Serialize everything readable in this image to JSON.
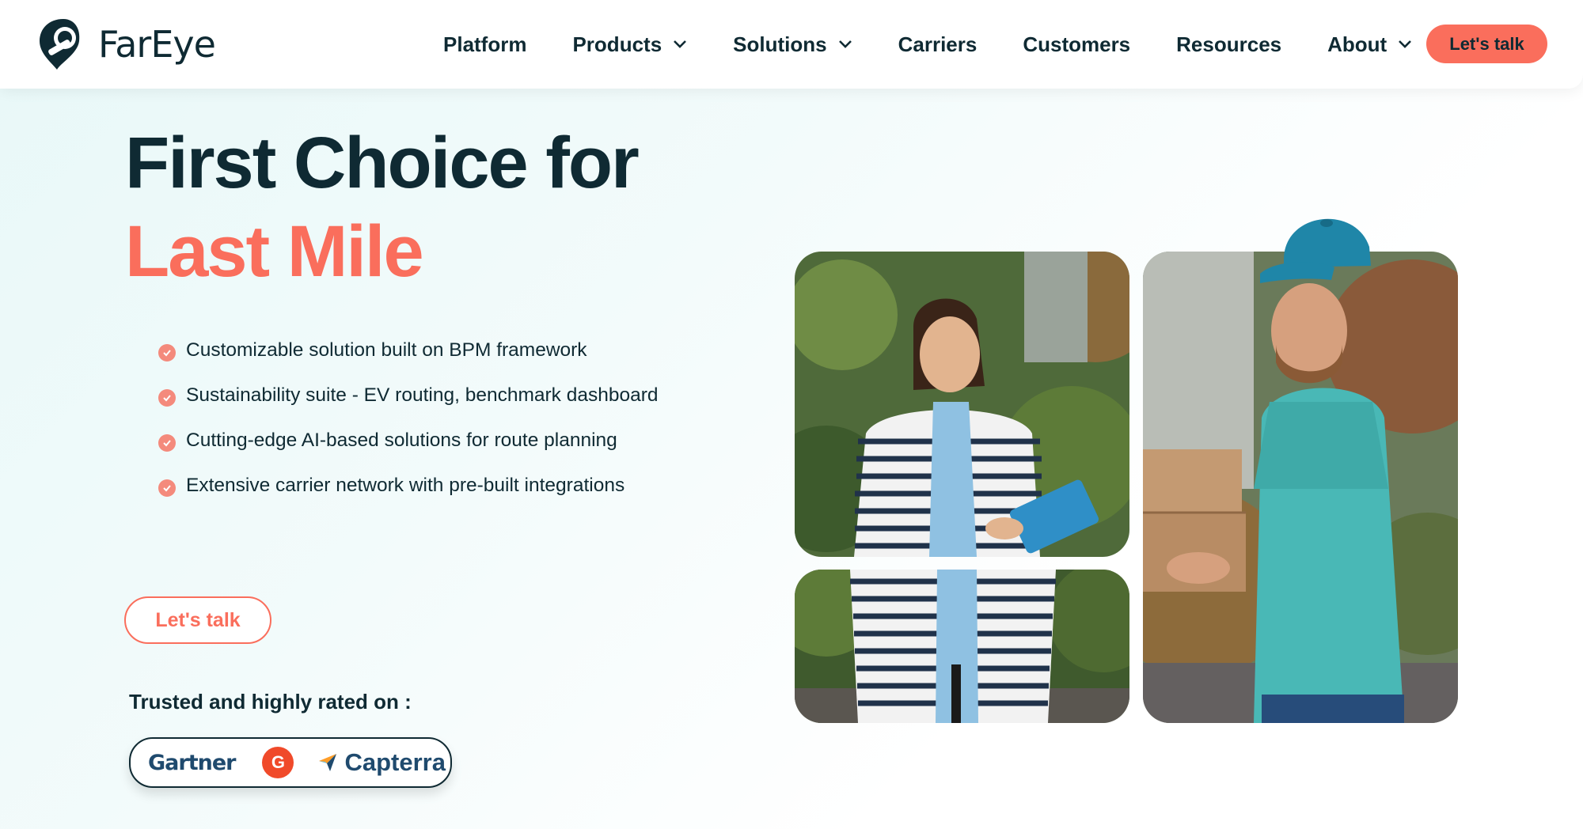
{
  "brand": {
    "name": "FarEye"
  },
  "nav": {
    "items": [
      {
        "label": "Platform",
        "dropdown": false
      },
      {
        "label": "Products",
        "dropdown": true
      },
      {
        "label": "Solutions",
        "dropdown": true
      },
      {
        "label": "Carriers",
        "dropdown": false
      },
      {
        "label": "Customers",
        "dropdown": false
      },
      {
        "label": "Resources",
        "dropdown": false
      },
      {
        "label": "About",
        "dropdown": true
      }
    ],
    "cta_label": "Let's talk"
  },
  "hero": {
    "title_line1": "First Choice for",
    "title_line2": "Last Mile",
    "features": [
      "Customizable solution built on BPM framework",
      "Sustainability suite - EV routing, benchmark dashboard",
      "Cutting-edge AI-based solutions for route planning",
      "Extensive carrier network with pre-built integrations"
    ],
    "cta_label": "Let's talk",
    "trusted_label": "Trusted and highly rated on :",
    "ratings": {
      "gartner": "Gartner",
      "g2": "G",
      "capterra": "Capterra"
    }
  },
  "colors": {
    "accent": "#fa6e5c",
    "text_dark": "#0f2a33",
    "background_tint": "#e8f8f8"
  }
}
